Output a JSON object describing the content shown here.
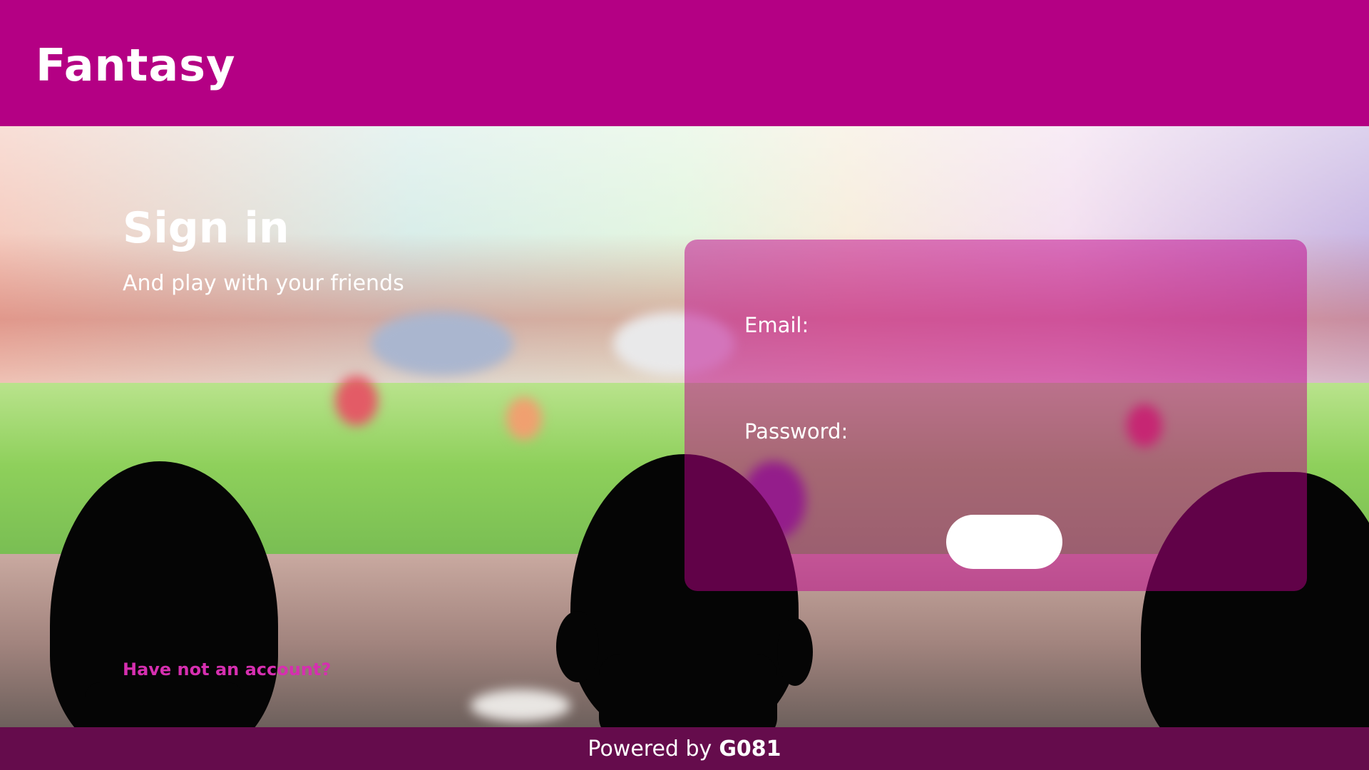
{
  "brand": {
    "name": "Fantasy"
  },
  "signin": {
    "title": "Sign in",
    "subtitle": "And play with your friends",
    "signup_link": "Have not an account?"
  },
  "form": {
    "email_label": "Email:",
    "email_value": "",
    "password_label": "Password:",
    "password_value": "",
    "submit_label": ""
  },
  "footer": {
    "prefix": "Powered by",
    "company": "G081"
  },
  "colors": {
    "brand_magenta": "#b40084",
    "footer_bg": "#650c4c",
    "link_pink": "#d62fb0"
  }
}
